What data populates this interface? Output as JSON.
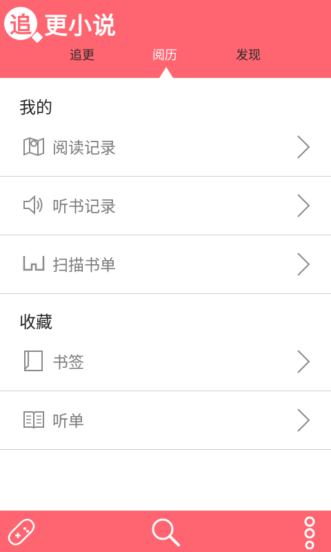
{
  "app": {
    "logo_char": "追",
    "logo_text": "更小说"
  },
  "tabs": [
    {
      "label": "追更"
    },
    {
      "label": "阅历"
    },
    {
      "label": "发现"
    }
  ],
  "sections": {
    "mine_title": "我的",
    "fav_title": "收藏"
  },
  "mine_items": [
    {
      "label": "阅读记录",
      "icon": "map-icon"
    },
    {
      "label": "听书记录",
      "icon": "speaker-icon"
    },
    {
      "label": "扫描书单",
      "icon": "scan-icon"
    }
  ],
  "fav_items": [
    {
      "label": "书签",
      "icon": "bookmark-icon"
    },
    {
      "label": "听单",
      "icon": "open-book-icon"
    }
  ],
  "colors": {
    "brand": "#ff6570",
    "text_dark": "#222222",
    "text_muted": "#7a7a7a",
    "divider": "#cfcfcf"
  }
}
